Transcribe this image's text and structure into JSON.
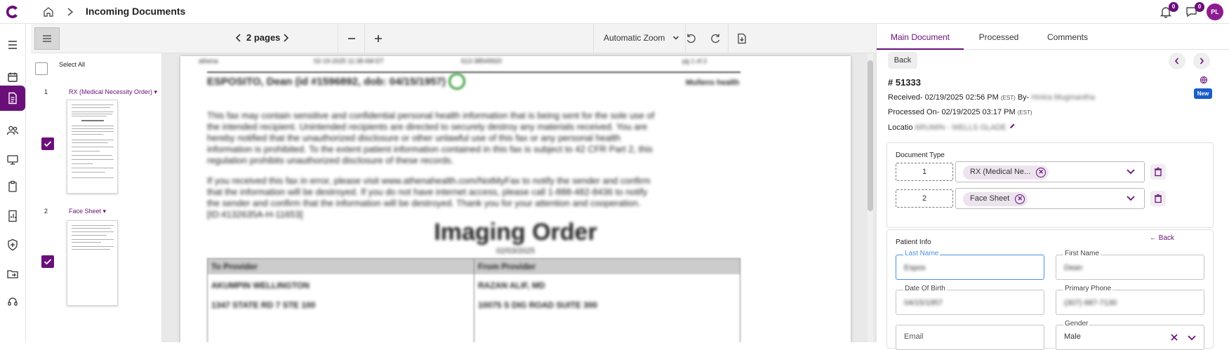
{
  "header": {
    "title": "Incoming Documents",
    "notifications_count": "0",
    "messages_count": "0",
    "avatar_initials": "PL"
  },
  "icons": [
    "logo-icon",
    "home-icon",
    "chevron-right-icon",
    "bell-icon",
    "chat-icon",
    "menu-icon",
    "calendar-icon",
    "document-icon",
    "users-icon",
    "monitor-icon",
    "clipboard-icon",
    "report-icon",
    "shield-plus-icon",
    "folder-export-icon",
    "headset-icon"
  ],
  "colors": {
    "brand": "#6a0f7a",
    "new_badge": "#1a5dc8",
    "focus": "#4a90e2"
  },
  "thumbnails": {
    "select_all": "Select All",
    "items": [
      {
        "num": "1",
        "label": "RX (Medical Necessity Order)",
        "checked": true
      },
      {
        "num": "2",
        "label": "Face Sheet",
        "checked": true
      }
    ]
  },
  "toolbar": {
    "pages": "2 pages",
    "zoom": "Automatic Zoom"
  },
  "document": {
    "header_left": "athena",
    "header_mid1": "02-19-2025 11:38 AM ET",
    "header_mid2": "613-38549920",
    "header_right": "pg 1 of 2",
    "patient_line": "ESPOSITO, Dean (id #1596892, dob: 04/15/1957)",
    "right_tag": "Mullens health",
    "para1": [
      "This fax may contain sensitive and confidential personal health information that is being sent for the sole use of",
      "the intended recipient. Unintended recipients are directed to securely destroy any materials received. You are",
      "hereby notified that the unauthorized disclosure or other unlawful use of this fax or any personal health",
      "information is prohibited. To the extent patient information contained in this fax is subject to 42 CFR Part 2, this",
      "regulation prohibits unauthorized disclosure of these records."
    ],
    "para2": [
      "If you received this fax in error, please visit www.athenahealth.com/NotMyFax to notify the sender and confirm",
      "that the information will be destroyed. If you do not have internet access, please call 1-888-482-8436 to notify",
      "the sender and confirm that the information will be destroyed. Thank you for your attention and cooperation.",
      "[ID:4132635A-H-11653]"
    ],
    "title": "Imaging Order",
    "date": "02/03/2025",
    "col1_head": "To Provider",
    "col2_head": "From Provider",
    "col1_r1": "AKUMPIN WELLINGTON",
    "col2_r1": "RAZAN ALIF, MD",
    "col1_r2": "1347 STATE RD 7 STE 100",
    "col2_r2": "10075 S DIG ROAD SUITE 300"
  },
  "right_panel": {
    "tabs": [
      "Main Document",
      "Processed",
      "Comments"
    ],
    "back": "Back",
    "doc_number": "# 51333",
    "received_label": "Received-",
    "received_value": "02/19/2025 02:56 PM",
    "received_tz": "(EST)",
    "by_label": "By-",
    "by_value": "Hmira Mugmantha",
    "processed_label": "Processed On-",
    "processed_value": "02/19/2025 03:17 PM",
    "processed_tz": "(EST)",
    "location_label": "Locatio",
    "location_value": "ARUMIN - WELLS GLADE",
    "new_badge": "New",
    "doc_type": {
      "title": "Document Type",
      "rows": [
        {
          "num": "1",
          "type": "RX (Medical Ne..."
        },
        {
          "num": "2",
          "type": "Face Sheet"
        }
      ]
    },
    "patient_info": {
      "title": "Patient Info",
      "back": "Back",
      "last_name_label": "Last Name",
      "last_name_value": "Espos",
      "first_name_label": "First Name",
      "first_name_value": "Dean",
      "dob_label": "Date Of Birth",
      "dob_value": "04/15/1957",
      "phone_label": "Primary Phone",
      "phone_value": "(307) 687-7130",
      "email_label": "Email",
      "gender_label": "Gender",
      "gender_value": "Male"
    }
  }
}
